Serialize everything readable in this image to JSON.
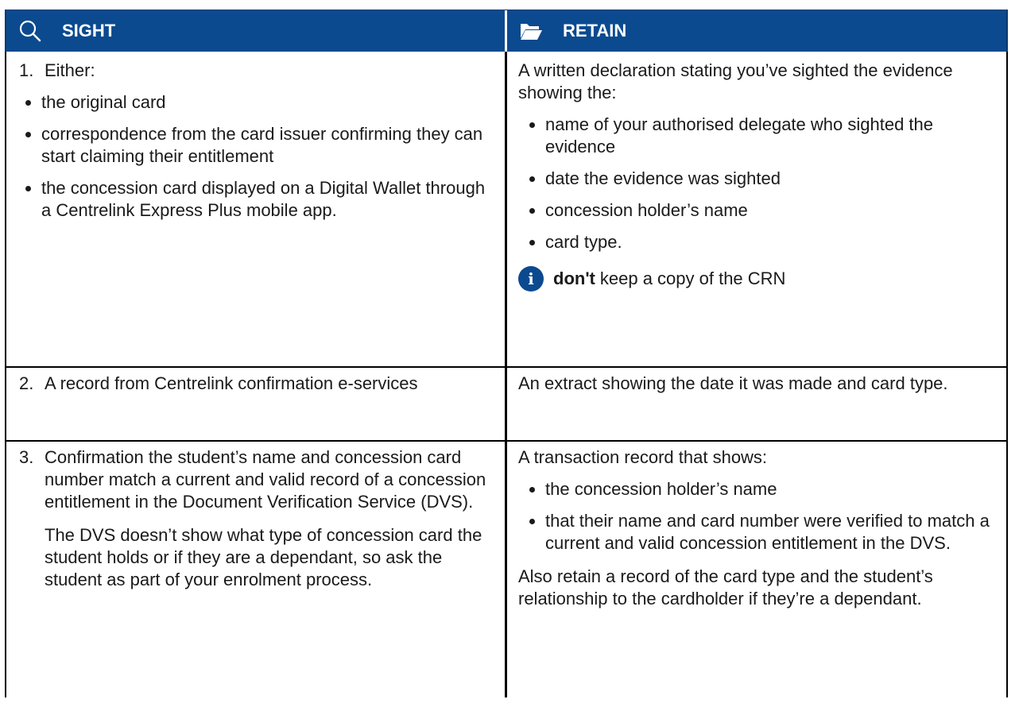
{
  "header": {
    "sight_label": "SIGHT",
    "sight_icon": "magnifier-icon",
    "retain_label": "RETAIN",
    "retain_icon": "folder-icon",
    "color": "#0b4a8f"
  },
  "rows": [
    {
      "left": {
        "number": "1.",
        "lead": "Either:",
        "bullets": [
          "the original card",
          "correspondence from the card issuer confirming they can start claiming their entitlement",
          "the concession card displayed on a Digital Wallet through a Centrelink Express Plus mobile app."
        ]
      },
      "right": {
        "lead": "A written declaration stating you’ve sighted the evidence showing the:",
        "bullets": [
          "name of your authorised delegate who sighted the evidence",
          "date the evidence was sighted",
          "concession holder’s name",
          "card type."
        ],
        "note_icon": "info-icon",
        "note_bold": "don't",
        "note_text": "keep a copy of the CRN"
      }
    },
    {
      "left": {
        "number": "2.",
        "lead": "A record from Centrelink confirmation e-services"
      },
      "right": {
        "lead": "An extract showing the date it was made and card type."
      }
    },
    {
      "left": {
        "number": "3.",
        "lead": "Confirmation the student’s name and concession card number match a current and valid record of a concession entitlement in the Document Verification Service (DVS).",
        "para": "The DVS doesn’t show what type of concession card the student holds or if they are a dependant, so ask the student as part of your enrolment process."
      },
      "right": {
        "lead": "A transaction record that shows:",
        "bullets": [
          "the concession holder’s name",
          "that their name and card number were verified to match a current and valid concession entitlement in the DVS."
        ],
        "para": "Also retain a record of the card type and the student’s relationship to the cardholder if they’re a dependant."
      }
    }
  ]
}
